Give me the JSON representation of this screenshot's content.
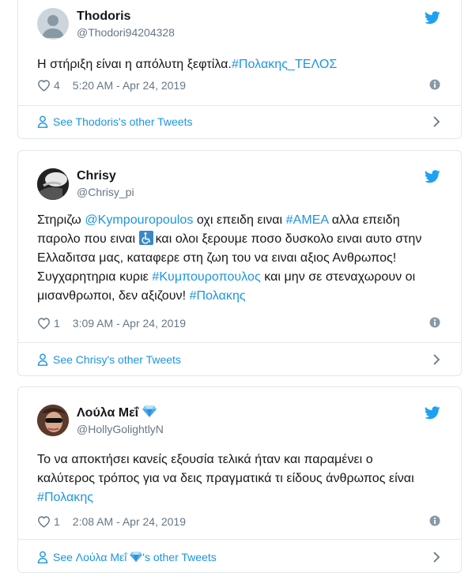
{
  "tweets": [
    {
      "name": "Thodoris",
      "handle": "@Thodori94204328",
      "text_parts": [
        "Η στήριξη είναι η απόλυτη ξεφτίλα.",
        "#Πολακης_ΤΕΛΟΣ"
      ],
      "likes": "4",
      "timestamp": "5:20 AM - Apr 24, 2019",
      "footer": "See Thodoris's other Tweets"
    },
    {
      "name": "Chrisy",
      "handle": "@Chrisy_pi",
      "line1": [
        "Στηριζω ",
        "@Kympouropoulos",
        " οχι επειδη ειναι ",
        "#ΑΜΕΑ",
        " αλλα επειδη"
      ],
      "line2": [
        "παρολο που ειναι ",
        "και ολοι ξερουμε ποσο δυσκολο ειναι αυτο στην"
      ],
      "line3": "Ελλαδιτσα μας, καταφερε στη ζωη του να ειναι αξιος Ανθρωπος!",
      "line4": [
        "Συγχαρητηρια κυριε ",
        "#Κυμπουροπουλος",
        " και μην σε στεναχωρουν οι"
      ],
      "line5": [
        "μισανθρωποι, δεν αξιζουν! ",
        "#Πολακης"
      ],
      "likes": "1",
      "timestamp": "3:09 AM - Apr 24, 2019",
      "footer": "See Chrisy's other Tweets"
    },
    {
      "name": "Λούλα Μεΐ",
      "handle": "@HollyGolightlyN",
      "line1": "Το να αποκτήσει κανείς εξουσία τελικά ήταν και παραμένει ο",
      "line2": "καλύτερος τρόπος για να δεις πραγματικά τι είδους άνθρωπος είναι",
      "line3": "#Πολακης",
      "likes": "1",
      "timestamp": "2:08 AM - Apr 24, 2019",
      "footer_pre": "See Λούλα Μεΐ ",
      "footer_post": "'s other Tweets"
    }
  ],
  "colors": {
    "link": "#1b95e0",
    "muted": "#657786",
    "border": "#e1e8ed"
  },
  "icons": [
    "twitter-bird-icon",
    "heart-icon",
    "info-icon",
    "person-icon",
    "chevron-right-icon",
    "gem-emoji-icon",
    "wheelchair-emoji-icon"
  ]
}
